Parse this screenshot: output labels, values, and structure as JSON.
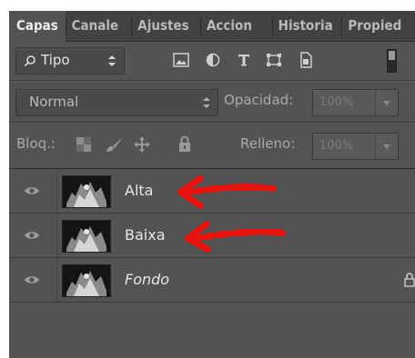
{
  "tabs": [
    "Capas",
    "Canale",
    "Ajustes",
    "Accion",
    "Historia",
    "Propied"
  ],
  "filter": {
    "label": "Tipo",
    "search_icon": "search-icon"
  },
  "filter_icons": [
    "image-filter-icon",
    "adjustment-filter-icon",
    "text-filter-icon",
    "shape-filter-icon",
    "smart-object-filter-icon"
  ],
  "blend": {
    "mode": "Normal",
    "opacity_label": "Opacidad:",
    "opacity_value": "100%"
  },
  "lock": {
    "label": "Bloq.:",
    "fill_label": "Relleno:",
    "fill_value": "100%"
  },
  "layers": [
    {
      "name": "Alta",
      "italic": false,
      "locked": false,
      "annotated": true
    },
    {
      "name": "Baixa",
      "italic": false,
      "locked": false,
      "annotated": true
    },
    {
      "name": "Fondo",
      "italic": true,
      "locked": true,
      "annotated": false
    }
  ],
  "colors": {
    "panel": "#535353",
    "tabbar": "#424242",
    "annotation_arrow": "#e8120c"
  }
}
